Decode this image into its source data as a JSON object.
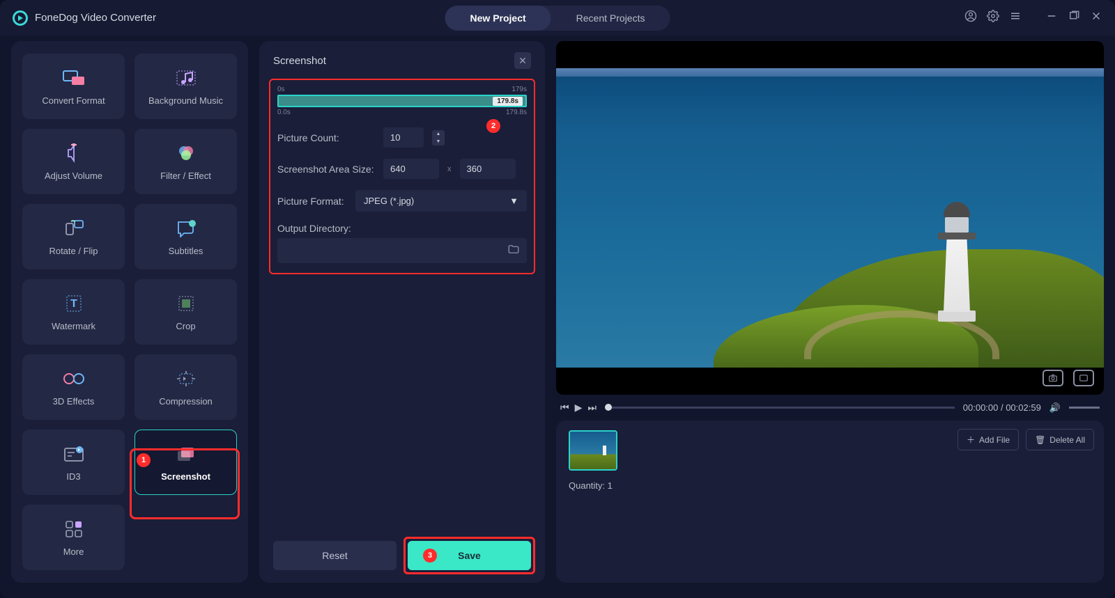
{
  "app": {
    "title": "FoneDog Video Converter"
  },
  "tabs": {
    "new": "New Project",
    "recent": "Recent Projects"
  },
  "tools": [
    {
      "id": "convert-format",
      "label": "Convert Format"
    },
    {
      "id": "background-music",
      "label": "Background Music"
    },
    {
      "id": "adjust-volume",
      "label": "Adjust Volume"
    },
    {
      "id": "filter-effect",
      "label": "Filter / Effect"
    },
    {
      "id": "rotate-flip",
      "label": "Rotate / Flip"
    },
    {
      "id": "subtitles",
      "label": "Subtitles"
    },
    {
      "id": "watermark",
      "label": "Watermark"
    },
    {
      "id": "crop",
      "label": "Crop"
    },
    {
      "id": "3d-effects",
      "label": "3D Effects"
    },
    {
      "id": "compression",
      "label": "Compression"
    },
    {
      "id": "id3",
      "label": "ID3"
    },
    {
      "id": "screenshot",
      "label": "Screenshot",
      "selected": true
    },
    {
      "id": "more",
      "label": "More"
    }
  ],
  "panel": {
    "title": "Screenshot",
    "timeline": {
      "start": "0s",
      "end": "179s",
      "tag": "179.8s",
      "rangeStart": "0.0s",
      "rangeEnd": "179.8s"
    },
    "pictureCount": {
      "label": "Picture Count:",
      "value": "10"
    },
    "areaSize": {
      "label": "Screenshot Area Size:",
      "w": "640",
      "h": "360",
      "sep": "x"
    },
    "format": {
      "label": "Picture Format:",
      "value": "JPEG (*.jpg)"
    },
    "outputDir": {
      "label": "Output Directory:"
    },
    "reset": "Reset",
    "save": "Save"
  },
  "player": {
    "time": "00:00:00 / 00:02:59"
  },
  "files": {
    "addFile": "Add File",
    "deleteAll": "Delete All",
    "quantity": "Quantity: 1"
  },
  "callouts": {
    "c1": "1",
    "c2": "2",
    "c3": "3"
  }
}
